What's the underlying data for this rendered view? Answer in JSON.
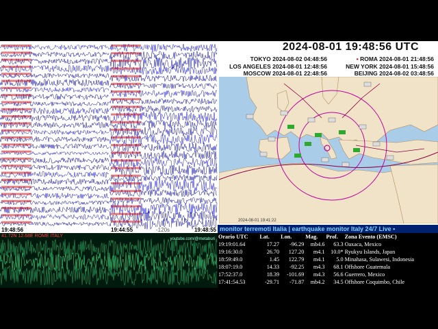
{
  "clock": {
    "utc": "2024-08-01   19:48:56   UTC",
    "zones": [
      {
        "city": "TOKYO",
        "time": "2024-08-02 04:48:56"
      },
      {
        "city": "ROMA",
        "time": "2024-08-01 21:48:56"
      },
      {
        "city": "LOS ANGELES",
        "time": "2024-08-01 12:48:56"
      },
      {
        "city": "NEW YORK",
        "time": "2024-08-01 15:48:56"
      },
      {
        "city": "MOSCOW",
        "time": "2024-08-01 22:48:56"
      },
      {
        "city": "BEIJING",
        "time": "2024-08-02 03:48:56"
      }
    ]
  },
  "seismograms": {
    "left_time": "19:48:56",
    "mid_time_left": "19:44:55",
    "mid_time_right": "19:48:55",
    "helicorder_label": "41.72N 12.68E ROME ITALY",
    "helicorder_credit": "youtube.com/@metaburi",
    "scale_label": "-120s"
  },
  "map": {
    "footer": "2024-08-01 19:41:22"
  },
  "ticker": {
    "text": "monitor terremoti Italia  |  earthquake monitor Italy 24/7 Live  •"
  },
  "quakes": {
    "headers": [
      "Orario UTC",
      "Lat.",
      "Lon.",
      "Mag.",
      "Prof.",
      "Zona Evento (EMSC)"
    ],
    "rows": [
      [
        "19:19:01.64",
        "17.27",
        "-96.29",
        "mb4.6",
        "63.3",
        "Oaxaca, Mexico"
      ],
      [
        "19:16:30.0",
        "26.70",
        "127.20",
        "m4.1",
        "10.0*",
        "Ryukyu Islands, Japan"
      ],
      [
        "18:59:49.0",
        "1.45",
        "122.79",
        "m4.1",
        "5.0",
        "Minahasa, Sulawesi, Indonesia"
      ],
      [
        "18:07:19.0",
        "14.33",
        "-92.25",
        "m4.3",
        "68.1",
        "Offshore Guatemala"
      ],
      [
        "17:52:37.0",
        "18.39",
        "-101.69",
        "m4.3",
        "56.6",
        "Guerrero, Mexico"
      ],
      [
        "17:41:54.53",
        "-29.71",
        "-71.87",
        "mb4.2",
        "34.5",
        "Offshore Coquimbo, Chile"
      ]
    ]
  }
}
